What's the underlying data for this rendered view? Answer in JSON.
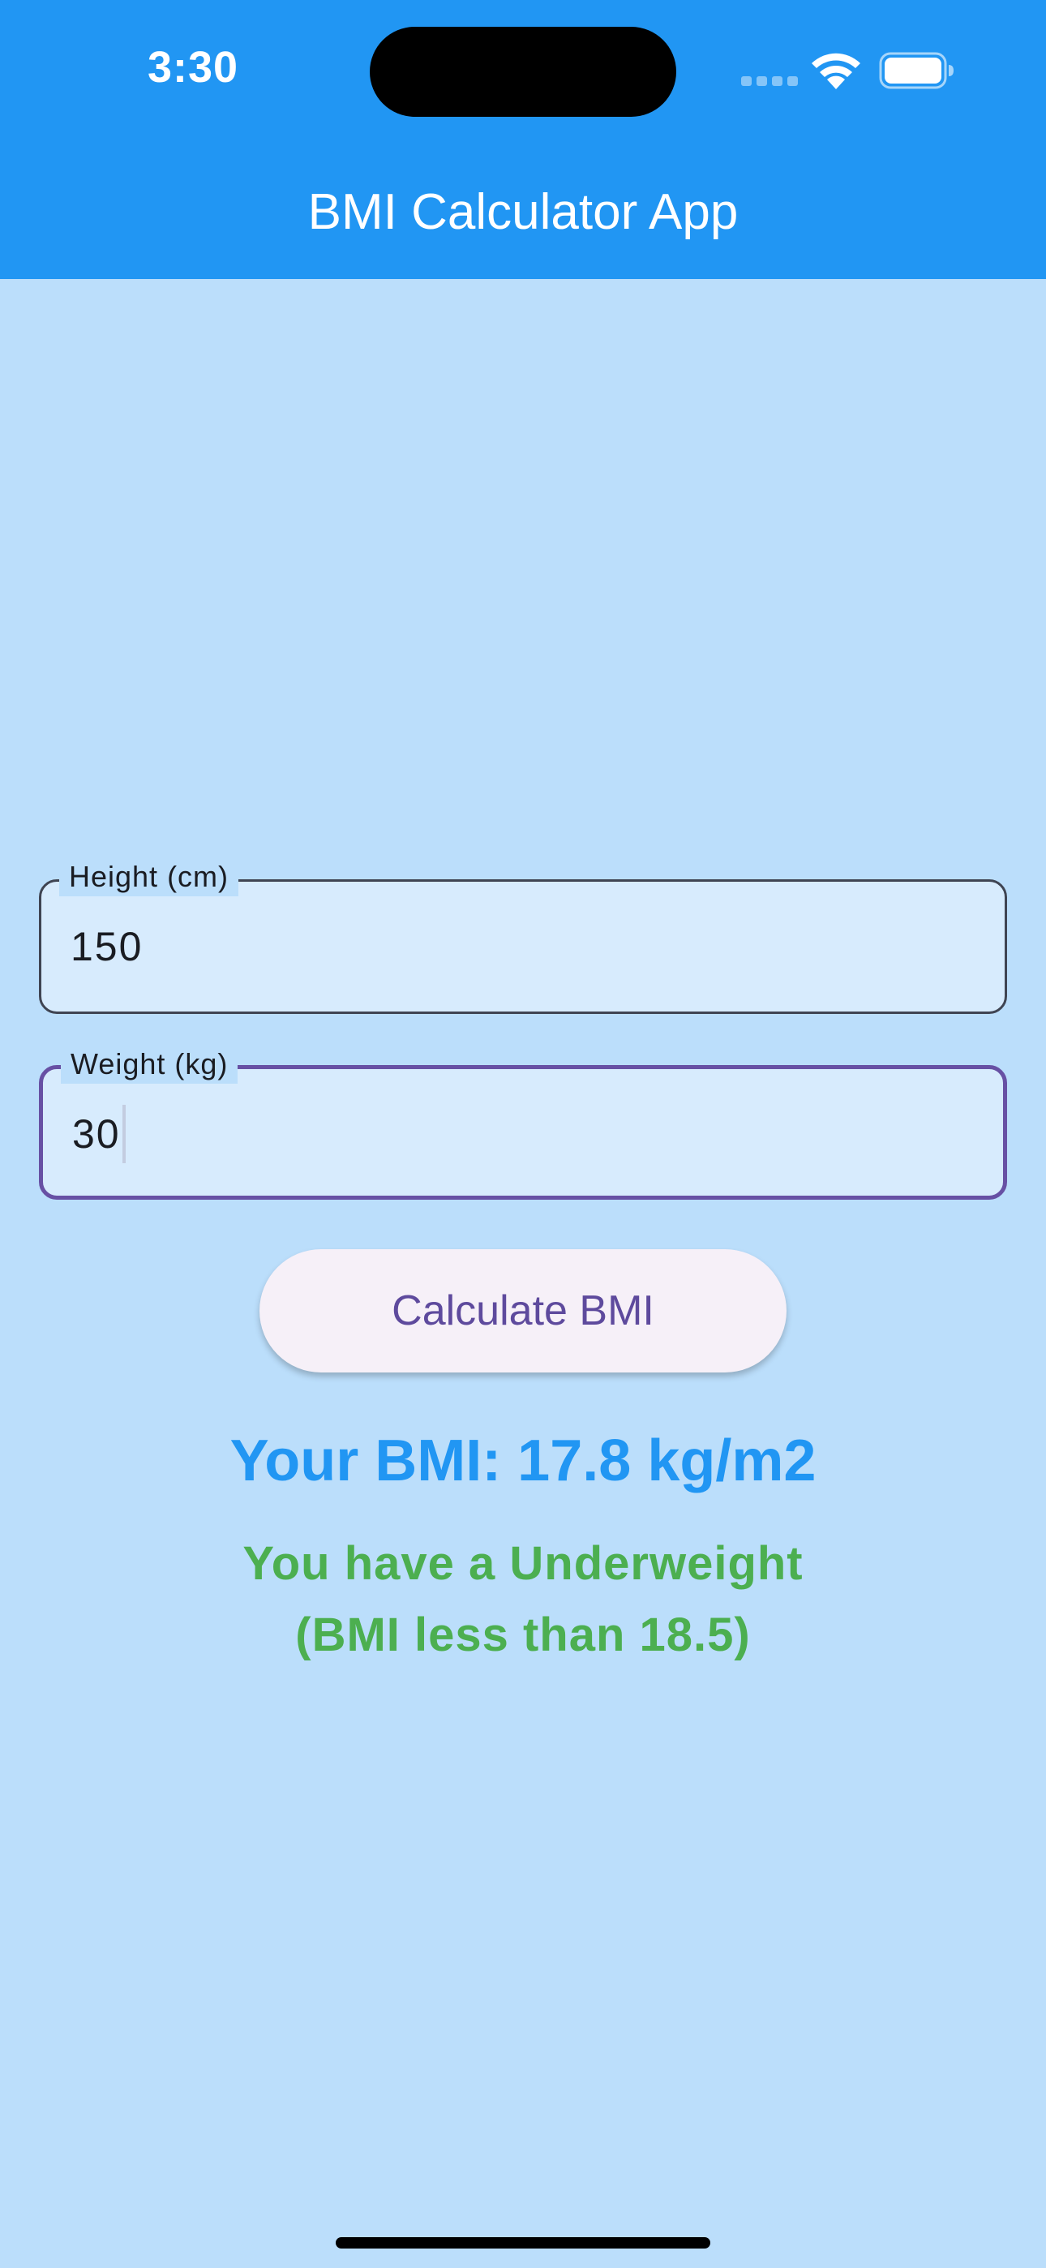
{
  "status_bar": {
    "time": "3:30"
  },
  "app_bar": {
    "title": "BMI Calculator App"
  },
  "form": {
    "height": {
      "label": "Height (cm)",
      "value": "150"
    },
    "weight": {
      "label": "Weight (kg)",
      "value": "30"
    }
  },
  "actions": {
    "calculate_label": "Calculate BMI"
  },
  "result": {
    "bmi_text": "Your BMI: 17.8 kg/m2",
    "category_line1": "You have a Underweight",
    "category_line2": "(BMI less than 18.5)"
  },
  "colors": {
    "app_bar": "#2196F3",
    "background": "#BBDEFB",
    "result_text": "#2196F3",
    "category_text": "#4CAF50",
    "focused_border": "#6750A4"
  },
  "icons": [
    "wifi-icon",
    "battery-icon",
    "cellular-signal-icon"
  ]
}
